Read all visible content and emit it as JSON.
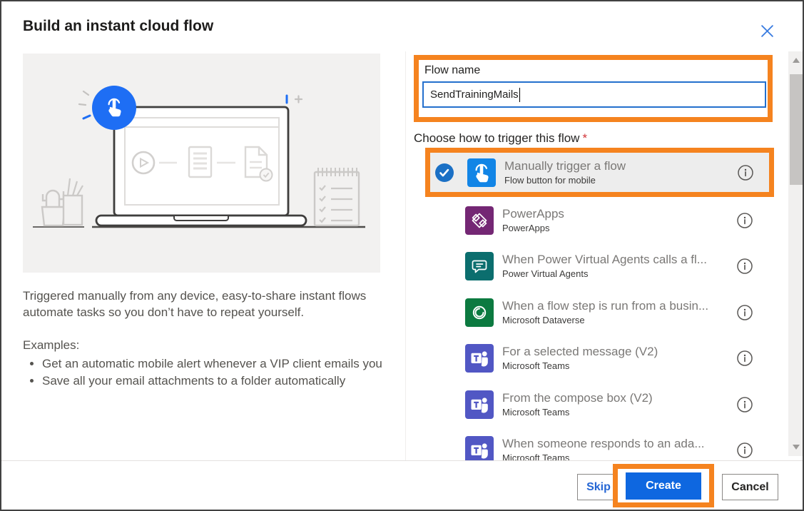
{
  "dialog": {
    "title": "Build an instant cloud flow"
  },
  "colors": {
    "annotation_orange": "#f5831f",
    "primary_blue": "#0e67e0",
    "check_blue": "#1b70c5",
    "link_blue": "#2f77e0",
    "illustration_blue": "#1e6ef4"
  },
  "left_panel": {
    "description": "Triggered manually from any device, easy-to-share instant flows automate tasks so you don’t have to repeat yourself.",
    "examples_label": "Examples:",
    "examples": [
      "Get an automatic mobile alert whenever a VIP client emails you",
      "Save all your email attachments to a folder automatically"
    ]
  },
  "form": {
    "flow_name_label": "Flow name",
    "flow_name_value": "SendTrainingMails",
    "trigger_label": "Choose how to trigger this flow",
    "required_marker": "*"
  },
  "triggers": [
    {
      "title": "Manually trigger a flow",
      "subtitle": "Flow button for mobile",
      "icon": "manual-trigger-tap-icon",
      "color": "#1285e6",
      "selected": true
    },
    {
      "title": "PowerApps",
      "subtitle": "PowerApps",
      "icon": "powerapps-icon",
      "color": "#742774",
      "selected": false
    },
    {
      "title": "When Power Virtual Agents calls a fl...",
      "subtitle": "Power Virtual Agents",
      "icon": "power-virtual-agents-chat-icon",
      "color": "#0b6e6e",
      "selected": false
    },
    {
      "title": "When a flow step is run from a busin...",
      "subtitle": "Microsoft Dataverse",
      "icon": "dataverse-icon",
      "color": "#0c7a40",
      "selected": false
    },
    {
      "title": "For a selected message (V2)",
      "subtitle": "Microsoft Teams",
      "icon": "teams-icon",
      "color": "#5157c4",
      "selected": false
    },
    {
      "title": "From the compose box (V2)",
      "subtitle": "Microsoft Teams",
      "icon": "teams-icon",
      "color": "#5157c4",
      "selected": false
    },
    {
      "title": "When someone responds to an ada...",
      "subtitle": "Microsoft Teams",
      "icon": "teams-icon",
      "color": "#5157c4",
      "selected": false
    }
  ],
  "footer": {
    "skip": "Skip",
    "create": "Create",
    "cancel": "Cancel"
  }
}
